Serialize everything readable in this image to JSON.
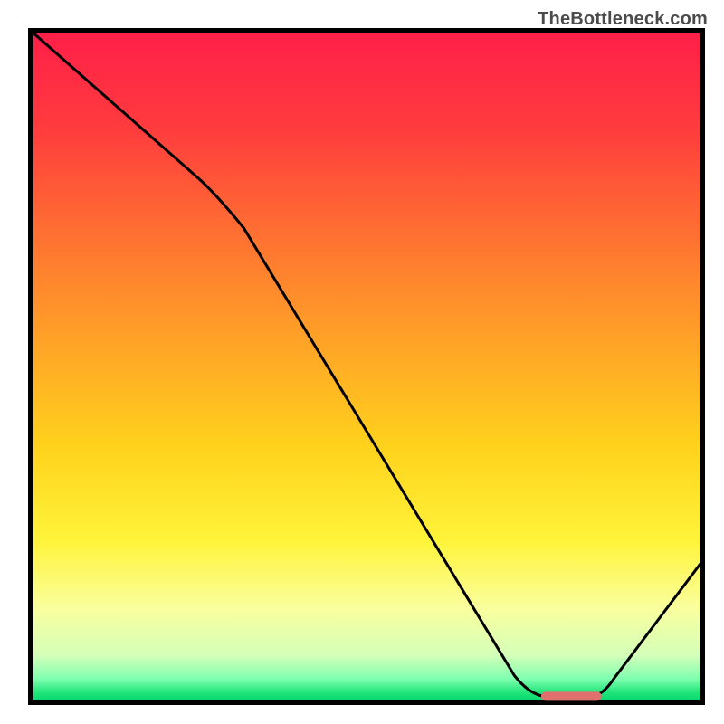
{
  "watermark": "TheBottleneck.com",
  "chart_data": {
    "type": "line",
    "title": "",
    "xlabel": "",
    "ylabel": "",
    "xlim": [
      0,
      100
    ],
    "ylim": [
      0,
      100
    ],
    "x": [
      0,
      25,
      72,
      78,
      84,
      100
    ],
    "values": [
      100,
      78,
      4,
      1,
      1,
      21
    ],
    "marker": {
      "x_start": 76,
      "x_end": 85,
      "y": 0.9
    },
    "gradient_stops": [
      {
        "offset": 0.0,
        "color": "#ff1f49"
      },
      {
        "offset": 0.14,
        "color": "#ff3a3e"
      },
      {
        "offset": 0.3,
        "color": "#ff6f32"
      },
      {
        "offset": 0.46,
        "color": "#ffa227"
      },
      {
        "offset": 0.62,
        "color": "#ffd21c"
      },
      {
        "offset": 0.76,
        "color": "#fff43a"
      },
      {
        "offset": 0.86,
        "color": "#faff9e"
      },
      {
        "offset": 0.93,
        "color": "#d4ffb8"
      },
      {
        "offset": 0.965,
        "color": "#7fffb0"
      },
      {
        "offset": 0.985,
        "color": "#22e57a"
      },
      {
        "offset": 1.0,
        "color": "#00d66a"
      }
    ],
    "axis_color": "#000000",
    "curve_stroke": "#000000",
    "curve_width": 3,
    "marker_fill": "#e0706d",
    "marker_height_px": 10,
    "marker_radius_px": 5
  }
}
